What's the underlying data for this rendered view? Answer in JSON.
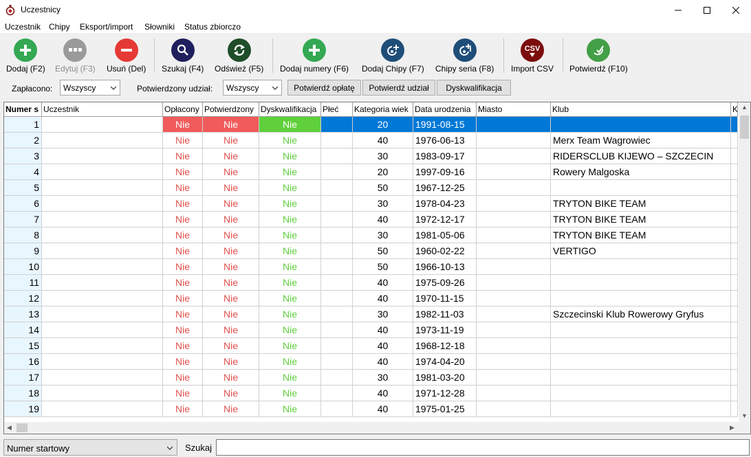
{
  "window": {
    "title": "Uczestnicy"
  },
  "menu": [
    "Uczestnik",
    "Chipy",
    "Eksport/import",
    "Słowniki",
    "Status zbiorczo"
  ],
  "toolbar": {
    "buttons": [
      {
        "label": "Dodaj (F2)",
        "icon": "plus-icon",
        "color": "#34a853",
        "enabled": true
      },
      {
        "label": "Edytuj (F3)",
        "icon": "ellipsis-icon",
        "color": "#9a9a9a",
        "enabled": false
      },
      {
        "label": "Usuń (Del)",
        "icon": "minus-icon",
        "color": "#e53935",
        "enabled": true
      },
      {
        "label": "Szukaj (F4)",
        "icon": "magnifier-icon",
        "color": "#1f1f5e",
        "enabled": true
      },
      {
        "label": "Odśwież (F5)",
        "icon": "refresh-icon",
        "color": "#1f4d2a",
        "enabled": true
      },
      {
        "label": "Dodaj numery (F6)",
        "icon": "plus-icon",
        "color": "#34a853",
        "enabled": true
      },
      {
        "label": "Dodaj Chipy (F7)",
        "icon": "chip-add-icon",
        "color": "#1f4e79",
        "enabled": true
      },
      {
        "label": "Chipy seria (F8)",
        "icon": "chip-series-icon",
        "color": "#1f4e79",
        "enabled": true
      },
      {
        "label": "Import CSV",
        "icon": "csv-icon",
        "color": "#7b0d0d",
        "enabled": true
      },
      {
        "label": "Potwierdź (F10)",
        "icon": "confirm-icon",
        "color": "#43a047",
        "enabled": true
      }
    ]
  },
  "filters": {
    "paid_label": "Zapłacono:",
    "paid_value": "Wszyscy",
    "confirmed_label": "Potwierdzony udział:",
    "confirmed_value": "Wszyscy",
    "btn_confirm_payment": "Potwierdź opłatę",
    "btn_confirm_participation": "Potwierdź udział",
    "btn_disqualify": "Dyskwalifikacja"
  },
  "table": {
    "columns": [
      "Numer s",
      "Uczestnik",
      "Opłacony",
      "Potwierdzony",
      "Dyskwalifikacja",
      "Płeć",
      "Kategoria wiek",
      "Data urodzenia",
      "Miasto",
      "Klub",
      "K"
    ],
    "rows": [
      {
        "num": "1",
        "uczestnik": "",
        "oplacony": "Nie",
        "potwierdzony": "Nie",
        "dyskw": "Nie",
        "plec": "",
        "kat": "20",
        "data": "1991-08-15",
        "miasto": "",
        "klub": ""
      },
      {
        "num": "2",
        "uczestnik": "",
        "oplacony": "Nie",
        "potwierdzony": "Nie",
        "dyskw": "Nie",
        "plec": "",
        "kat": "40",
        "data": "1976-06-13",
        "miasto": "",
        "klub": "Merx Team Wagrowiec"
      },
      {
        "num": "3",
        "uczestnik": "",
        "oplacony": "Nie",
        "potwierdzony": "Nie",
        "dyskw": "Nie",
        "plec": "",
        "kat": "30",
        "data": "1983-09-17",
        "miasto": "",
        "klub": "RIDERSCLUB KIJEWO – SZCZECIN"
      },
      {
        "num": "4",
        "uczestnik": "",
        "oplacony": "Nie",
        "potwierdzony": "Nie",
        "dyskw": "Nie",
        "plec": "",
        "kat": "20",
        "data": "1997-09-16",
        "miasto": "",
        "klub": "Rowery Malgoska"
      },
      {
        "num": "5",
        "uczestnik": "",
        "oplacony": "Nie",
        "potwierdzony": "Nie",
        "dyskw": "Nie",
        "plec": "",
        "kat": "50",
        "data": "1967-12-25",
        "miasto": "",
        "klub": ""
      },
      {
        "num": "6",
        "uczestnik": "",
        "oplacony": "Nie",
        "potwierdzony": "Nie",
        "dyskw": "Nie",
        "plec": "",
        "kat": "30",
        "data": "1978-04-23",
        "miasto": "",
        "klub": "TRYTON BIKE TEAM"
      },
      {
        "num": "7",
        "uczestnik": "",
        "oplacony": "Nie",
        "potwierdzony": "Nie",
        "dyskw": "Nie",
        "plec": "",
        "kat": "40",
        "data": "1972-12-17",
        "miasto": "",
        "klub": "TRYTON BIKE TEAM"
      },
      {
        "num": "8",
        "uczestnik": "",
        "oplacony": "Nie",
        "potwierdzony": "Nie",
        "dyskw": "Nie",
        "plec": "",
        "kat": "30",
        "data": "1981-05-06",
        "miasto": "",
        "klub": "TRYTON BIKE TEAM"
      },
      {
        "num": "9",
        "uczestnik": "",
        "oplacony": "Nie",
        "potwierdzony": "Nie",
        "dyskw": "Nie",
        "plec": "",
        "kat": "50",
        "data": "1960-02-22",
        "miasto": "",
        "klub": "VERTIGO"
      },
      {
        "num": "10",
        "uczestnik": "",
        "oplacony": "Nie",
        "potwierdzony": "Nie",
        "dyskw": "Nie",
        "plec": "",
        "kat": "50",
        "data": "1966-10-13",
        "miasto": "",
        "klub": ""
      },
      {
        "num": "11",
        "uczestnik": "",
        "oplacony": "Nie",
        "potwierdzony": "Nie",
        "dyskw": "Nie",
        "plec": "",
        "kat": "40",
        "data": "1975-09-26",
        "miasto": "",
        "klub": ""
      },
      {
        "num": "12",
        "uczestnik": "",
        "oplacony": "Nie",
        "potwierdzony": "Nie",
        "dyskw": "Nie",
        "plec": "",
        "kat": "40",
        "data": "1970-11-15",
        "miasto": "",
        "klub": ""
      },
      {
        "num": "13",
        "uczestnik": "",
        "oplacony": "Nie",
        "potwierdzony": "Nie",
        "dyskw": "Nie",
        "plec": "",
        "kat": "30",
        "data": "1982-11-03",
        "miasto": "",
        "klub": "Szczecinski Klub Rowerowy Gryfus"
      },
      {
        "num": "14",
        "uczestnik": "",
        "oplacony": "Nie",
        "potwierdzony": "Nie",
        "dyskw": "Nie",
        "plec": "",
        "kat": "40",
        "data": "1973-11-19",
        "miasto": "",
        "klub": ""
      },
      {
        "num": "15",
        "uczestnik": "",
        "oplacony": "Nie",
        "potwierdzony": "Nie",
        "dyskw": "Nie",
        "plec": "",
        "kat": "40",
        "data": "1968-12-18",
        "miasto": "",
        "klub": ""
      },
      {
        "num": "16",
        "uczestnik": "",
        "oplacony": "Nie",
        "potwierdzony": "Nie",
        "dyskw": "Nie",
        "plec": "",
        "kat": "40",
        "data": "1974-04-20",
        "miasto": "",
        "klub": ""
      },
      {
        "num": "17",
        "uczestnik": "",
        "oplacony": "Nie",
        "potwierdzony": "Nie",
        "dyskw": "Nie",
        "plec": "",
        "kat": "30",
        "data": "1981-03-20",
        "miasto": "",
        "klub": ""
      },
      {
        "num": "18",
        "uczestnik": "",
        "oplacony": "Nie",
        "potwierdzony": "Nie",
        "dyskw": "Nie",
        "plec": "",
        "kat": "40",
        "data": "1971-12-28",
        "miasto": "",
        "klub": ""
      },
      {
        "num": "19",
        "uczestnik": "",
        "oplacony": "Nie",
        "potwierdzony": "Nie",
        "dyskw": "Nie",
        "plec": "",
        "kat": "40",
        "data": "1975-01-25",
        "miasto": "",
        "klub": ""
      }
    ],
    "selected_row": 0
  },
  "bottom": {
    "field_select": "Numer startowy",
    "search_label": "Szukaj",
    "search_value": ""
  },
  "colors": {
    "selection": "#0078d7",
    "no_red": "#e0504a",
    "no_green": "#5fce3d",
    "number_col_bg": "#e8f6fe"
  }
}
